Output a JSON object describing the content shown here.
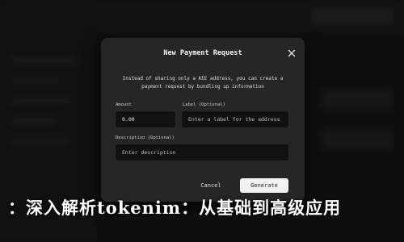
{
  "modal": {
    "title": "New Payment Request",
    "description": "Instead of sharing only a KEE address, you can create a payment request by bundling up information",
    "amount": {
      "label": "Amount",
      "value": "0.00"
    },
    "label_field": {
      "label": "Label (Optional)",
      "placeholder": "Enter a label for the address"
    },
    "description_field": {
      "label": "Description (Optional)",
      "placeholder": "Enter description"
    },
    "cancel_label": "Cancel",
    "generate_label": "Generate"
  },
  "caption": {
    "text": "：深入解析tokenim：从基础到高级应用"
  },
  "colors": {
    "modal_bg": "#262626",
    "field_bg": "#111111",
    "primary_button": "#f2f2f2"
  },
  "icons": {
    "close": "close-icon"
  }
}
